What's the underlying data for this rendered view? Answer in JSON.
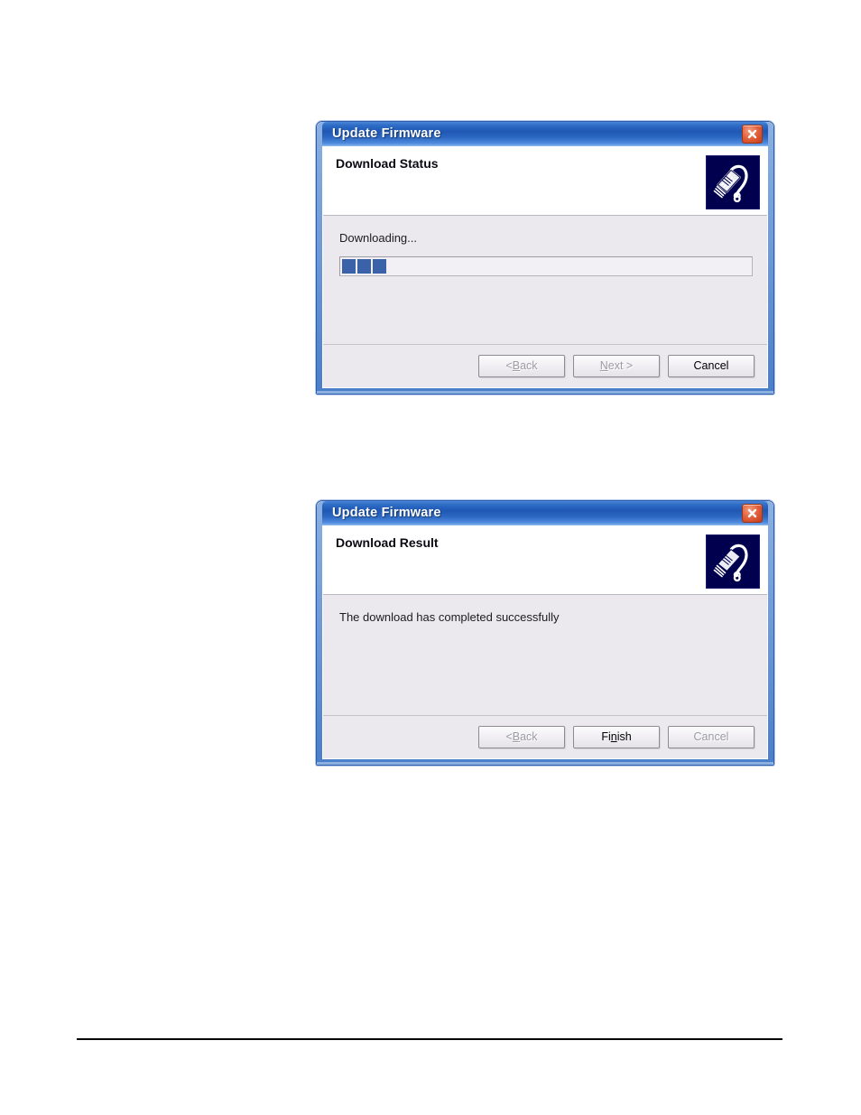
{
  "page": {
    "background_color": "#ffffff",
    "rule_color": "#000000"
  },
  "dialogs": [
    {
      "title": "Update Firmware",
      "close_icon": "close-icon",
      "header_title": "Download Status",
      "header_icon": "barcode-scanner-icon",
      "status_text": "Downloading...",
      "progress": {
        "chunks": 3,
        "chunk_color": "#3a62a8",
        "track_color": "#f2f0f4"
      },
      "buttons": [
        {
          "id": "back",
          "label": "< Back",
          "mnemonic": "B",
          "enabled": false
        },
        {
          "id": "next",
          "label": "Next >",
          "mnemonic": "N",
          "enabled": false
        },
        {
          "id": "cancel",
          "label": "Cancel",
          "mnemonic": "",
          "enabled": true
        }
      ]
    },
    {
      "title": "Update Firmware",
      "close_icon": "close-icon",
      "header_title": "Download Result",
      "header_icon": "barcode-scanner-icon",
      "message": "The download has completed successfully",
      "buttons": [
        {
          "id": "back",
          "label": "< Back",
          "mnemonic": "B",
          "enabled": false
        },
        {
          "id": "finish",
          "label": "Finish",
          "mnemonic": "n",
          "enabled": true
        },
        {
          "id": "cancel",
          "label": "Cancel",
          "mnemonic": "",
          "enabled": false
        }
      ]
    }
  ],
  "colors": {
    "titlebar_blue": "#1f58b4",
    "frame_blue": "#6f9bd8",
    "close_red": "#e2613b",
    "body_grey": "#ece9ee",
    "icon_navy": "#00004e"
  }
}
